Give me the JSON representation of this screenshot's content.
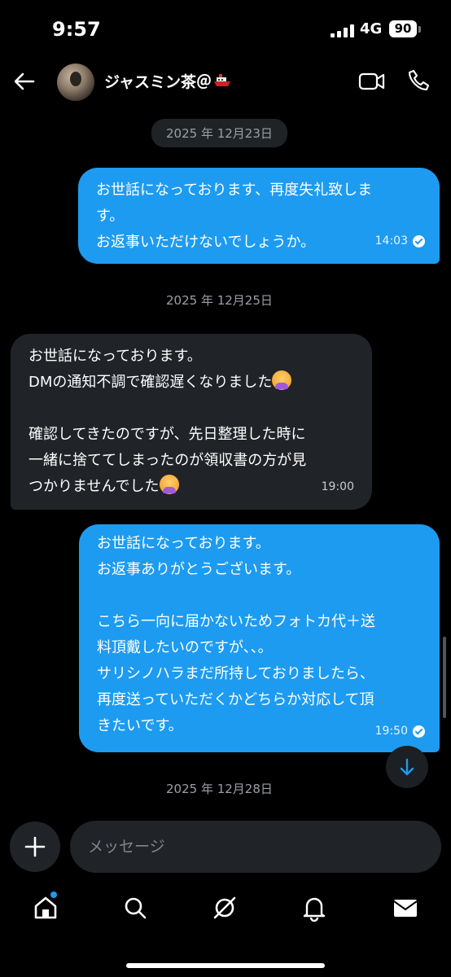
{
  "status_bar": {
    "time": "9:57",
    "network": "4G",
    "battery": "90"
  },
  "header": {
    "contact_name": "ジャスミン茶＠"
  },
  "dates": [
    "2025 年 12月23日",
    "2025 年 12月25日",
    "2025 年 12月28日"
  ],
  "messages": [
    {
      "direction": "out",
      "text": "お世話になっております、再度失礼致しま\nす。\nお返事いただけないでしょうか。",
      "time": "14:03",
      "read": true
    },
    {
      "direction": "in",
      "text_1": "お世話になっております。\nDMの通知不調で確認遅くなりました",
      "text_2": "\n\n確認してきたのですが、先日整理した時に\n一緒に捨ててしまったのが領収書の方が見\nつかりませんでした",
      "time": "19:00"
    },
    {
      "direction": "out",
      "text": "お世話になっております。\nお返事ありがとうございます。\n\nこちら一向に届かないためフォトカ代＋送\n料頂戴したいのですが、、。\nサリシノハラまだ所持しておりましたら、\n再度送っていただくかどちらか対応して頂\nきたいです。",
      "time": "19:50",
      "read": true
    }
  ],
  "composer": {
    "placeholder": "メッセージ"
  },
  "icons": [
    "back-arrow-icon",
    "video-call-icon",
    "phone-call-icon",
    "plus-icon",
    "arrow-down-icon",
    "home-icon",
    "search-icon",
    "grok-icon",
    "bell-icon",
    "mail-icon"
  ],
  "colors": {
    "accent": "#1d9bf0",
    "incoming_bubble": "#202327",
    "background": "#000000"
  }
}
